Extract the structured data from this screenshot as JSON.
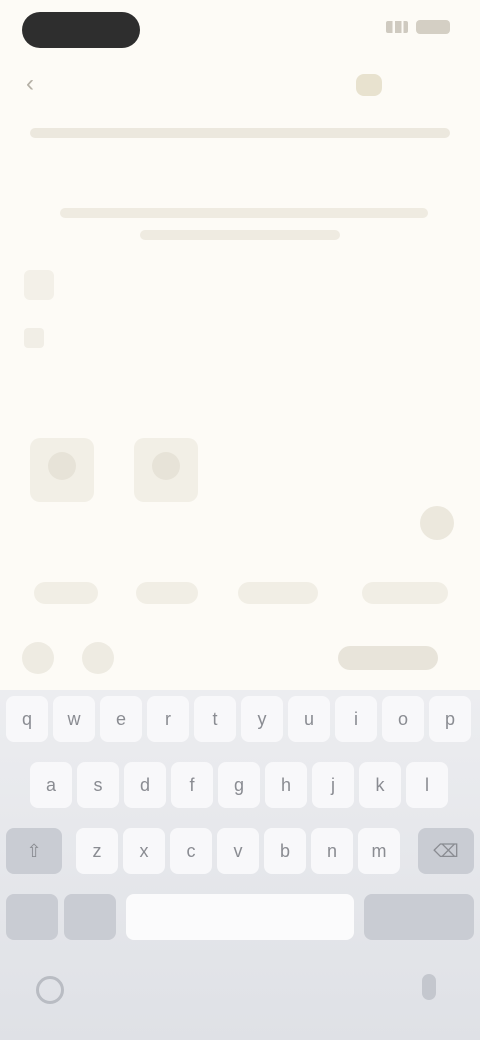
{
  "status_bar": {
    "time": ""
  },
  "header": {
    "title": "",
    "action_label": ""
  },
  "subtitle": "",
  "suggestions": [
    "",
    "",
    "",
    ""
  ],
  "keyboard": {
    "row1": [
      "q",
      "w",
      "e",
      "r",
      "t",
      "y",
      "u",
      "i",
      "o",
      "p"
    ],
    "row2": [
      "a",
      "s",
      "d",
      "f",
      "g",
      "h",
      "j",
      "k",
      "l"
    ],
    "row3": [
      "z",
      "x",
      "c",
      "v",
      "b",
      "n",
      "m"
    ],
    "space_label": "",
    "return_label": ""
  },
  "colors": {
    "background": "#fdfbf6",
    "keyboard": "#e3e5ea",
    "time_pill": "#2e2e2e"
  },
  "icons": [
    "back-icon",
    "signal-icon",
    "battery-icon",
    "image-icon",
    "send-icon",
    "globe-icon",
    "mic-icon"
  ]
}
